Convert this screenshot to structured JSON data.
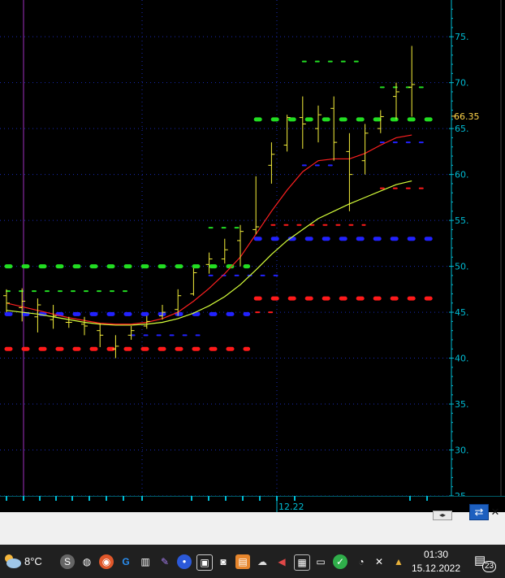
{
  "chart_data": {
    "type": "candlestick",
    "y_ticks": [
      "75.",
      "70.",
      "65.",
      "60.",
      "55.",
      "50.",
      "45.",
      "40.",
      "35.",
      "30.",
      "25"
    ],
    "ylim": [
      25,
      79
    ],
    "x_label": "12.22",
    "last_value": "66.35",
    "grid": true,
    "bars": [
      {
        "x": 0,
        "h": 47.5,
        "l": 45.0,
        "o": 46.8,
        "c": 46.0
      },
      {
        "x": 1,
        "h": 47.6,
        "l": 44.0,
        "o": 45.5,
        "c": 46.2
      },
      {
        "x": 2,
        "h": 46.5,
        "l": 42.8,
        "o": 44.5,
        "c": 45.8
      },
      {
        "x": 3,
        "h": 45.8,
        "l": 43.2,
        "o": 44.2,
        "c": 44.6
      },
      {
        "x": 4,
        "h": 44.5,
        "l": 43.3,
        "o": 43.9,
        "c": 43.9
      },
      {
        "x": 5,
        "h": 44.5,
        "l": 42.5,
        "o": 43.7,
        "c": 43.5
      },
      {
        "x": 6,
        "h": 43.8,
        "l": 41.2,
        "o": 43.0,
        "c": 42.5
      },
      {
        "x": 7,
        "h": 42.5,
        "l": 40.0,
        "o": 41.0,
        "c": 41.3
      },
      {
        "x": 8,
        "h": 43.5,
        "l": 42.0,
        "o": 42.5,
        "c": 43.0
      },
      {
        "x": 9,
        "h": 44.6,
        "l": 43.2,
        "o": 43.5,
        "c": 44.0
      },
      {
        "x": 10,
        "h": 45.8,
        "l": 44.2,
        "o": 44.6,
        "c": 45.0
      },
      {
        "x": 11,
        "h": 47.5,
        "l": 44.6,
        "o": 45.3,
        "c": 46.8
      },
      {
        "x": 12,
        "h": 49.8,
        "l": 46.8,
        "o": 47.0,
        "c": 49.3
      },
      {
        "x": 13,
        "h": 51.5,
        "l": 49.2,
        "o": 50.2,
        "c": 50.8
      },
      {
        "x": 14,
        "h": 53.0,
        "l": 50.3,
        "o": 50.8,
        "c": 51.8
      },
      {
        "x": 15,
        "h": 54.5,
        "l": 50.0,
        "o": 52.8,
        "c": 53.8
      },
      {
        "x": 16,
        "h": 59.8,
        "l": 53.5,
        "o": 54.0,
        "c": 54.3
      },
      {
        "x": 17,
        "h": 63.5,
        "l": 59.0,
        "o": 61.0,
        "c": 62.2
      },
      {
        "x": 18,
        "h": 66.5,
        "l": 62.5,
        "o": 63.2,
        "c": 66.2
      },
      {
        "x": 19,
        "h": 68.5,
        "l": 62.8,
        "o": 66.2,
        "c": 65.5
      },
      {
        "x": 20,
        "h": 67.5,
        "l": 63.5,
        "o": 65.0,
        "c": 66.5
      },
      {
        "x": 21,
        "h": 68.5,
        "l": 61.5,
        "o": 67.2,
        "c": 63.5
      },
      {
        "x": 22,
        "h": 64.5,
        "l": 56.0,
        "o": 62.5,
        "c": 60.0
      },
      {
        "x": 23,
        "h": 65.5,
        "l": 60.0,
        "o": 61.5,
        "c": 64.5
      },
      {
        "x": 24,
        "h": 67.0,
        "l": 64.5,
        "o": 65.0,
        "c": 66.3
      },
      {
        "x": 25,
        "h": 70.0,
        "l": 66.0,
        "o": 68.5,
        "c": 69.0
      },
      {
        "x": 26,
        "h": 74.0,
        "l": 66.3,
        "o": 69.5,
        "c": 69.8
      }
    ],
    "ma_fast": [
      46.0,
      45.6,
      45.2,
      44.8,
      44.4,
      44.1,
      43.8,
      43.7,
      43.7,
      43.9,
      44.3,
      45.0,
      46.2,
      47.6,
      49.2,
      51.0,
      53.5,
      56.0,
      58.3,
      60.3,
      61.5,
      61.7,
      61.7,
      62.3,
      63.2,
      64.0,
      64.3
    ],
    "ma_slow": [
      45.2,
      45.0,
      44.8,
      44.5,
      44.2,
      43.9,
      43.7,
      43.6,
      43.6,
      43.7,
      43.9,
      44.3,
      44.9,
      45.7,
      46.7,
      48.0,
      49.6,
      51.3,
      52.8,
      54.0,
      55.2,
      56.0,
      56.8,
      57.5,
      58.2,
      58.9,
      59.3
    ],
    "dotted_levels": [
      {
        "color": "#22dd22",
        "y": 50.0,
        "x_from": 0,
        "x_to": 15.5,
        "style": "big"
      },
      {
        "color": "#2222ff",
        "y": 44.8,
        "x_from": 0,
        "x_to": 15.5,
        "style": "big"
      },
      {
        "color": "#ff1a1a",
        "y": 41.0,
        "x_from": 0,
        "x_to": 15.5,
        "style": "big"
      },
      {
        "color": "#22dd22",
        "y": 66.0,
        "x_from": 16.0,
        "x_to": 27.2,
        "style": "big"
      },
      {
        "color": "#2222ff",
        "y": 53.0,
        "x_from": 16.0,
        "x_to": 27.2,
        "style": "big"
      },
      {
        "color": "#ff1a1a",
        "y": 46.5,
        "x_from": 16.0,
        "x_to": 27.2,
        "style": "big"
      },
      {
        "color": "#22dd22",
        "y": 47.3,
        "x_from": 0,
        "x_to": 8,
        "style": "small"
      },
      {
        "color": "#2222ff",
        "y": 42.5,
        "x_from": 8,
        "x_to": 12.5,
        "style": "small"
      },
      {
        "color": "#22dd22",
        "y": 54.2,
        "x_from": 13,
        "x_to": 15.5,
        "style": "small"
      },
      {
        "color": "#2222ff",
        "y": 49.0,
        "x_from": 13,
        "x_to": 17.5,
        "style": "small"
      },
      {
        "color": "#ff1a1a",
        "y": 45.0,
        "x_from": 16,
        "x_to": 17.5,
        "style": "small"
      },
      {
        "color": "#22dd22",
        "y": 72.3,
        "x_from": 19,
        "x_to": 23,
        "style": "small"
      },
      {
        "color": "#2222ff",
        "y": 61.0,
        "x_from": 19,
        "x_to": 21.5,
        "style": "small"
      },
      {
        "color": "#ff1a1a",
        "y": 54.5,
        "x_from": 17,
        "x_to": 23,
        "style": "small"
      },
      {
        "color": "#2222ff",
        "y": 63.5,
        "x_from": 24,
        "x_to": 27,
        "style": "small"
      },
      {
        "color": "#ff1a1a",
        "y": 58.5,
        "x_from": 24,
        "x_to": 27,
        "style": "small"
      },
      {
        "color": "#22dd22",
        "y": 69.5,
        "x_from": 24,
        "x_to": 27,
        "style": "small"
      }
    ],
    "colors": {
      "bars": "#f5ef3a",
      "ma_fast": "#ff2020",
      "ma_slow": "#d6ff3a",
      "grid": "#1a2bb8",
      "axis": "#00bcd4",
      "marker": "#a030c0"
    }
  },
  "taskbar": {
    "weather_temp": "8°C",
    "time": "01:30",
    "date": "15.12.2022",
    "notification_count": "23",
    "icons": [
      "s-app-icon",
      "globe-icon",
      "fire-browser-icon",
      "g-app-icon",
      "film-icon",
      "feather-icon",
      "blue-app-icon",
      "camera-window-icon",
      "photo-camera-icon",
      "orange-app-icon",
      "cloud-close-icon",
      "speaker-icon",
      "calculator-icon",
      "battery-icon",
      "shield-check-icon",
      "wifi-icon",
      "mute-icon",
      "lock-icon"
    ]
  }
}
